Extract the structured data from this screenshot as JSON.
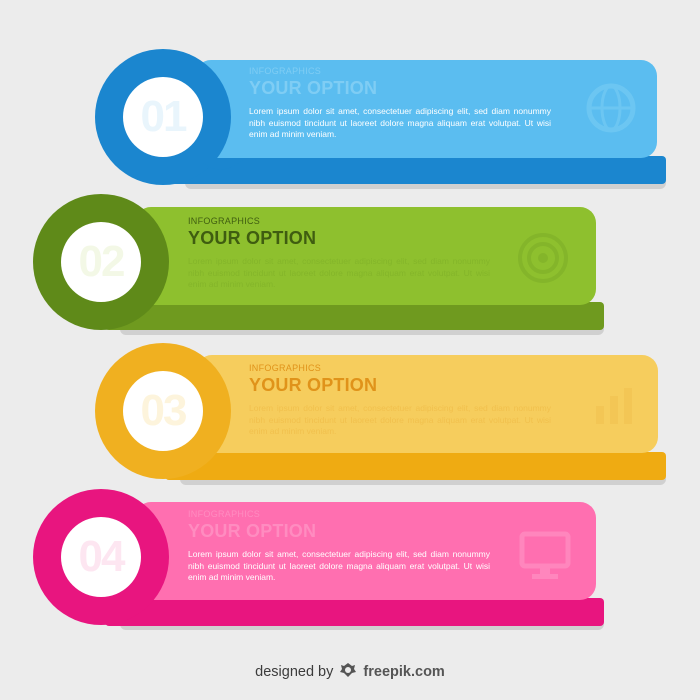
{
  "items": [
    {
      "number": "01",
      "kicker": "INFOGRAPHICS",
      "title": "YOUR OPTION",
      "body": "Lorem ipsum dolor sit amet, consectetuer adipiscing elit, sed diam nonummy nibh euismod tincidunt ut laoreet dolore magna aliquam erat volutpat. Ut wisi enim ad minim veniam.",
      "icon": "globe-icon",
      "colors": {
        "main": "#5bbdf0",
        "dark": "#1b86cf",
        "circle": "#1b86cf"
      }
    },
    {
      "number": "02",
      "kicker": "INFOGRAPHICS",
      "title": "YOUR OPTION",
      "body": "Lorem ipsum dolor sit amet, consectetuer adipiscing elit, sed diam nonummy nibh euismod tincidunt ut laoreet dolore magna aliquam erat volutpat. Ut wisi enim ad minim veniam.",
      "icon": "target-icon",
      "colors": {
        "main": "#8ec02e",
        "dark": "#6f9a1f",
        "circle": "#5f8a19"
      }
    },
    {
      "number": "03",
      "kicker": "INFOGRAPHICS",
      "title": "YOUR OPTION",
      "body": "Lorem ipsum dolor sit amet, consectetuer adipiscing elit, sed diam nonummy nibh euismod tincidunt ut laoreet dolore magna aliquam erat volutpat. Ut wisi enim ad minim veniam.",
      "icon": "chart-icon",
      "colors": {
        "main": "#f6cd5d",
        "dark": "#efab12",
        "circle": "#f0b020"
      }
    },
    {
      "number": "04",
      "kicker": "INFOGRAPHICS",
      "title": "YOUR OPTION",
      "body": "Lorem ipsum dolor sit amet, consectetuer adipiscing elit, sed diam nonummy nibh euismod tincidunt ut laoreet dolore magna aliquam erat volutpat. Ut wisi enim ad minim veniam.",
      "icon": "monitor-icon",
      "colors": {
        "main": "#ff6fb0",
        "dark": "#e8157f",
        "circle": "#e8157f"
      }
    }
  ],
  "credit": {
    "prefix": "designed by",
    "brand": "freepik.com"
  }
}
